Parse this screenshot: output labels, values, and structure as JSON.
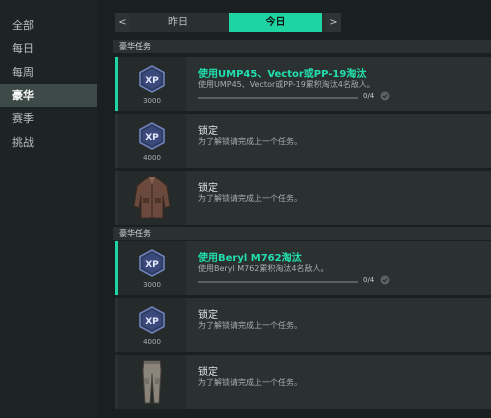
{
  "sidebar": {
    "items": [
      {
        "label": "全部",
        "active": false
      },
      {
        "label": "每日",
        "active": false
      },
      {
        "label": "每周",
        "active": false
      },
      {
        "label": "豪华",
        "active": true
      },
      {
        "label": "赛季",
        "active": false
      },
      {
        "label": "挑战",
        "active": false
      }
    ]
  },
  "tabs": {
    "prev_arrow": "<",
    "next_arrow": ">",
    "items": [
      {
        "label": "昨日",
        "active": false
      },
      {
        "label": "今日",
        "active": true
      }
    ]
  },
  "sections": [
    {
      "header": "豪华任务",
      "missions": [
        {
          "title": "使用UMP45、Vector或PP-19淘汰",
          "desc": "使用UMP45、Vector或PP-19累积淘汰4名敌人。",
          "reward_type": "xp",
          "reward_value": "3000",
          "progress": "0/4",
          "progress_fraction": 0,
          "active": true
        },
        {
          "title": "锁定",
          "desc": "为了解锁请完成上一个任务。",
          "reward_type": "xp",
          "reward_value": "4000",
          "active": false
        },
        {
          "title": "锁定",
          "desc": "为了解锁请完成上一个任务。",
          "reward_type": "jacket",
          "active": false
        }
      ]
    },
    {
      "header": "豪华任务",
      "missions": [
        {
          "title": "使用Beryl M762淘汰",
          "desc": "使用Beryl M762累积淘汰4名敌人。",
          "reward_type": "xp",
          "reward_value": "3000",
          "progress": "0/4",
          "progress_fraction": 0,
          "active": true
        },
        {
          "title": "锁定",
          "desc": "为了解锁请完成上一个任务。",
          "reward_type": "xp",
          "reward_value": "4000",
          "active": false
        },
        {
          "title": "锁定",
          "desc": "为了解锁请完成上一个任务。",
          "reward_type": "pants",
          "active": false
        }
      ]
    }
  ],
  "badge_text": "XP",
  "colors": {
    "accent": "#1ed4a3",
    "title_active": "#22e0ad"
  }
}
